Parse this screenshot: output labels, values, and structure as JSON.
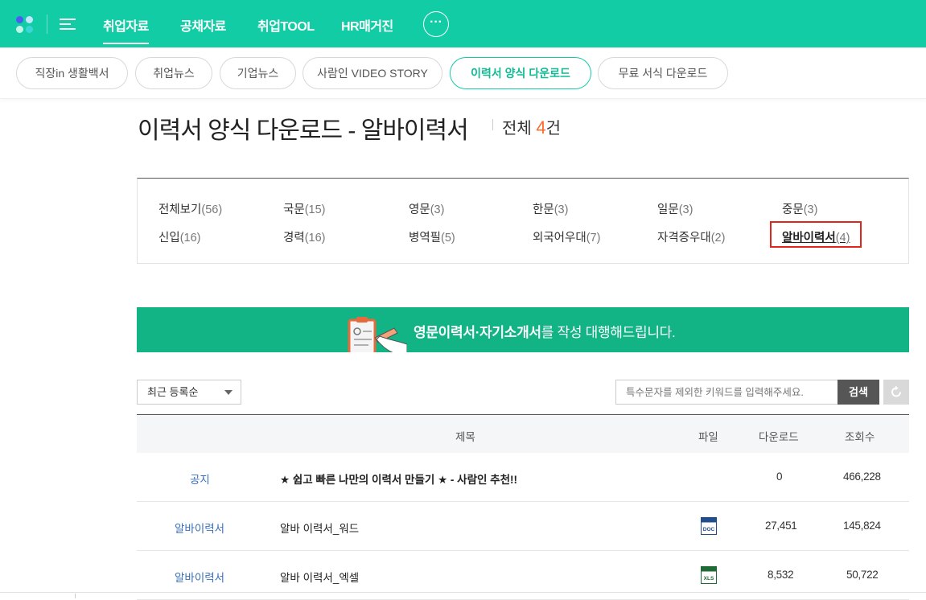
{
  "gnb": {
    "menu": [
      "취업자료",
      "공채자료",
      "취업TOOL",
      "HR매거진"
    ],
    "more_label": "···"
  },
  "subnav": {
    "pills": [
      "직장in 생활백서",
      "취업뉴스",
      "기업뉴스",
      "사람인 VIDEO STORY",
      "이력서 양식 다운로드",
      "무료 서식 다운로드"
    ],
    "active": "이력서 양식 다운로드"
  },
  "page": {
    "title": "이력서 양식 다운로드 - 알바이력서",
    "total_label": "전체",
    "total_count": "4",
    "total_unit": "건"
  },
  "categories": [
    {
      "name": "전체보기",
      "count": "(56)"
    },
    {
      "name": "국문",
      "count": "(15)"
    },
    {
      "name": "영문",
      "count": "(3)"
    },
    {
      "name": "한문",
      "count": "(3)"
    },
    {
      "name": "일문",
      "count": "(3)"
    },
    {
      "name": "중문",
      "count": "(3)"
    },
    {
      "name": "신입",
      "count": "(16)"
    },
    {
      "name": "경력",
      "count": "(16)"
    },
    {
      "name": "병역필",
      "count": "(5)"
    },
    {
      "name": "외국어우대",
      "count": "(7)"
    },
    {
      "name": "자격증우대",
      "count": "(2)"
    },
    {
      "name": "알바이력서",
      "count": "(4)",
      "selected": true
    }
  ],
  "banner": {
    "bold": "영문이력서·자기소개서",
    "rest": "를 작성 대행해드립니다."
  },
  "controls": {
    "sort_value": "최근 등록순",
    "search_placeholder": "특수문자를 제외한 키워드를 입력해주세요.",
    "search_button": "검색"
  },
  "table": {
    "headers": {
      "title": "제목",
      "file": "파일",
      "downloads": "다운로드",
      "views": "조회수"
    },
    "rows": [
      {
        "category": "공지",
        "title": "★ 쉽고 빠른 나만의 이력서 만들기 ★ - 사람인 추천!!",
        "file": "",
        "downloads": "0",
        "views": "466,228"
      },
      {
        "category": "알바이력서",
        "title": "알바 이력서_워드",
        "file": "DOC",
        "downloads": "27,451",
        "views": "145,824"
      },
      {
        "category": "알바이력서",
        "title": "알바 이력서_엑셀",
        "file": "XLS",
        "downloads": "8,532",
        "views": "50,722"
      }
    ]
  },
  "colors": {
    "brand": "#12cca5",
    "banner": "#12b486",
    "accent_count": "#ff6a2b",
    "link": "#3a6fb8",
    "selection_box": "#e0261b"
  }
}
